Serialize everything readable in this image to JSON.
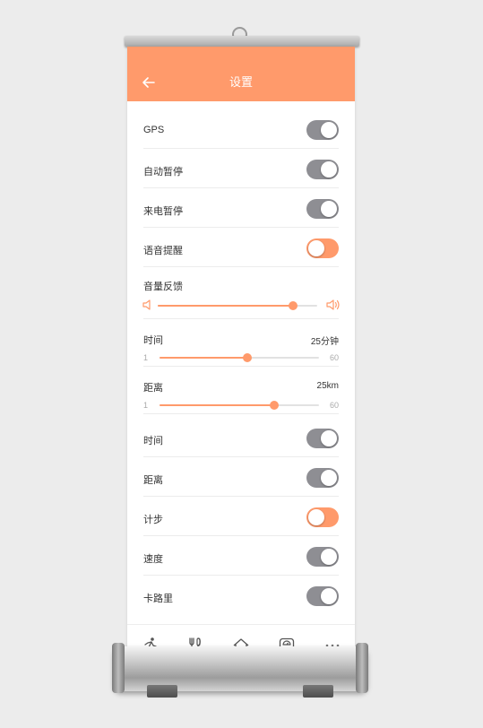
{
  "header": {
    "title": "设置"
  },
  "colors": {
    "accent": "#ff9a6b",
    "toggle_off": "#8e8e93"
  },
  "settings": {
    "gps": {
      "label": "GPS",
      "on": false
    },
    "auto_pause": {
      "label": "自动暂停",
      "on": false
    },
    "call_pause": {
      "label": "来电暂停",
      "on": false
    },
    "voice_prompt": {
      "label": "语音提醒",
      "on": true
    },
    "volume": {
      "label": "音量反馈",
      "level": 0.85
    },
    "time_slider": {
      "label": "时间",
      "value": "25分钟",
      "min": "1",
      "max": "60",
      "level": 0.55
    },
    "distance_slider": {
      "label": "距离",
      "value": "25km",
      "min": "1",
      "max": "60",
      "level": 0.72
    },
    "time_toggle": {
      "label": "时间",
      "on": false
    },
    "distance_toggle": {
      "label": "距离",
      "on": false
    },
    "steps": {
      "label": "计步",
      "on": true
    },
    "speed": {
      "label": "速度",
      "on": false
    },
    "calories": {
      "label": "卡路里",
      "on": false
    }
  },
  "tabbar": {
    "items": [
      {
        "icon": "running-icon"
      },
      {
        "icon": "diet-icon"
      },
      {
        "icon": "home-icon"
      },
      {
        "icon": "scale-icon"
      },
      {
        "icon": "more-icon"
      }
    ]
  }
}
